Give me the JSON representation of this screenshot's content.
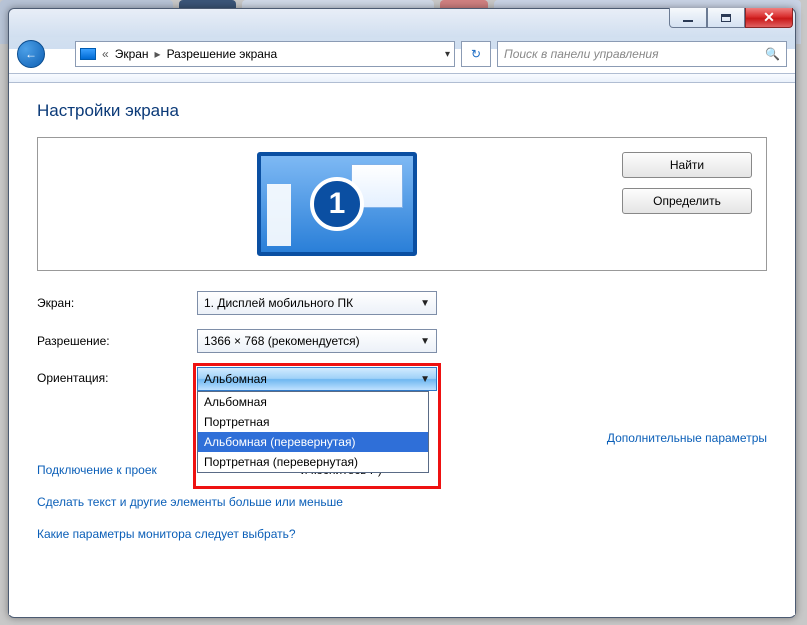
{
  "window_controls": {
    "min": "minimize",
    "max": "maximize",
    "close": "close"
  },
  "breadcrumb": {
    "root": "Экран",
    "current": "Разрешение экрана"
  },
  "search_placeholder": "Поиск в панели управления",
  "page_title": "Настройки экрана",
  "monitor_number": "1",
  "buttons": {
    "find": "Найти",
    "identify": "Определить"
  },
  "rows": {
    "display": {
      "label": "Экран:",
      "value": "1. Дисплей мобильного ПК"
    },
    "resolution": {
      "label": "Разрешение:",
      "value": "1366 × 768 (рекомендуется)"
    },
    "orientation": {
      "label": "Ориентация:",
      "selected": "Альбомная"
    }
  },
  "orientation_options": {
    "o0": "Альбомная",
    "o1": "Портретная",
    "o2": "Альбомная (перевернутая)",
    "o3": "Портретная (перевернутая)"
  },
  "links": {
    "advanced": "Дополнительные параметры",
    "projector_prefix": "Подключение к проек",
    "projector_suffix": "и коснитесь P)",
    "textsize": "Сделать текст и другие элементы больше или меньше",
    "which": "Какие параметры монитора следует выбрать?"
  }
}
